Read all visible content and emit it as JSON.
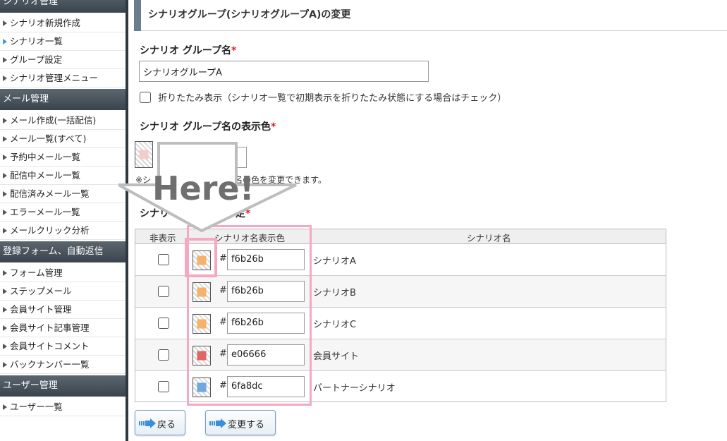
{
  "sidebar": {
    "sections": [
      {
        "title": "シナリオ管理",
        "items": [
          "シナリオ新規作成",
          "シナリオ一覧",
          "グループ設定",
          "シナリオ管理メニュー"
        ]
      },
      {
        "title": "メール管理",
        "items": [
          "メール作成(一括配信)",
          "メール一覧(すべて)",
          "予約中メール一覧",
          "配信中メール一覧",
          "配信済みメール一覧",
          "エラーメール一覧",
          "メールクリック分析"
        ]
      },
      {
        "title": "登録フォーム、自動返信",
        "items": [
          "フォーム管理",
          "ステップメール",
          "会員サイト管理",
          "会員サイト記事管理",
          "会員サイトコメント",
          "バックナンバー一覧"
        ]
      },
      {
        "title": "ユーザー管理",
        "items": [
          "ユーザー一覧"
        ]
      }
    ],
    "active_item": "シナリオ一覧"
  },
  "page": {
    "title": "シナリオグループ(シナリオグループA)の変更",
    "group_name_label": "シナリオ グループ名",
    "required_mark": "*",
    "group_name_value": "シナリオグループA",
    "collapse_label": "折りたたみ表示（シナリオ一覧で初期表示を折りたたみ状態にする場合はチェック）",
    "display_color_label": "シナリオ グループ名の表示色",
    "display_color_note_start": "※シ",
    "display_color_note_end": "名の色を変更できます。",
    "scenario_label_start": "シナリ",
    "scenario_label_end": "定"
  },
  "table": {
    "headers": {
      "hide": "非表示",
      "color": "シナリオ名表示色",
      "name": "シナリオ名"
    },
    "rows": [
      {
        "hex": "f6b26b",
        "name": "シナリオA",
        "color": "#f6b26b"
      },
      {
        "hex": "f6b26b",
        "name": "シナリオB",
        "color": "#f6b26b"
      },
      {
        "hex": "f6b26b",
        "name": "シナリオC",
        "color": "#f6b26b"
      },
      {
        "hex": "e06666",
        "name": "会員サイト",
        "color": "#e06666"
      },
      {
        "hex": "6fa8dc",
        "name": "パートナーシナリオ",
        "color": "#6fa8dc"
      }
    ],
    "hash_symbol": "#"
  },
  "callout": {
    "text": "Here!"
  },
  "buttons": {
    "back": "戻る",
    "submit": "変更する"
  },
  "colors": {
    "highlight": "#f5a7c4",
    "group_display_color": "#f4cccc",
    "sidebar_header": "#3a444c",
    "required": "#e02020"
  }
}
